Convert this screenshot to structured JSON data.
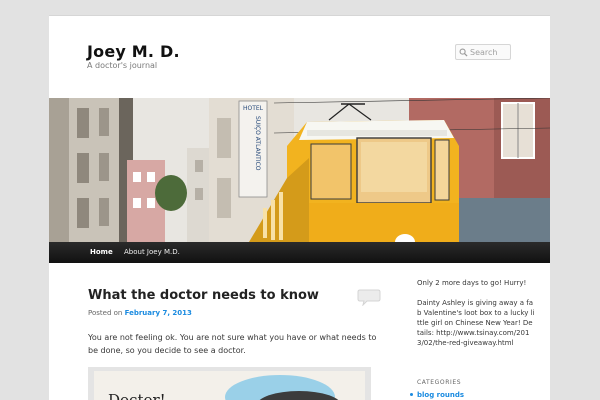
{
  "site": {
    "title": "Joey M. D.",
    "description": "A doctor's journal"
  },
  "search": {
    "placeholder": "Search"
  },
  "banner": {
    "hotel_sign_top": "HOTEL",
    "hotel_sign_side": "SUIÇO ATLANTICO"
  },
  "nav": {
    "items": [
      {
        "label": "Home"
      },
      {
        "label": "About Joey M.D."
      }
    ]
  },
  "post": {
    "title": "What the doctor needs to know",
    "meta_prefix": "Posted on",
    "date": "February 7, 2013",
    "body": "You are not feeling ok.  You are not sure what you have or what needs to be done, so you decide to see a doctor.",
    "image_text": "Doctor!"
  },
  "sidebar": {
    "p1": "Only 2 more days to go! Hurry!",
    "p2": "Dainty Ashley is giving away a fab Valentine's loot box to a lucky little girl on Chinese New Year! Details: http://www.tsinay.com/2013/02/the-red-giveaway.html",
    "categories_title": "Categories",
    "categories": [
      {
        "label": "blog rounds"
      }
    ]
  },
  "colors": {
    "link": "#1b8be0",
    "nav_bg": "#111111",
    "page_bg": "#e2e2e2",
    "tram_yellow": "#f2b31f"
  }
}
